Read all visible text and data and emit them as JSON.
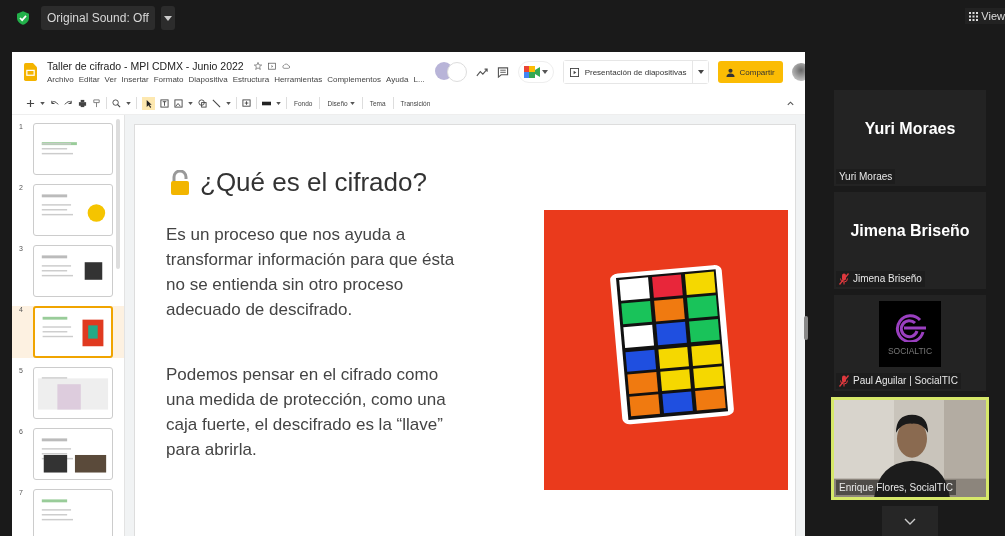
{
  "meeting_bar": {
    "original_sound": "Original Sound: Off",
    "view": "View"
  },
  "document": {
    "title": "Taller de cifrado - MPI CDMX - Junio 2022",
    "menu": [
      "Archivo",
      "Editar",
      "Ver",
      "Insertar",
      "Formato",
      "Diapositiva",
      "Estructura",
      "Herramientas",
      "Complementos",
      "Ayuda",
      "L..."
    ],
    "present_button": "Presentación de diapositivas",
    "share_button": "Compartir",
    "toolbar": [
      {
        "label": "Fondo",
        "dropdown": false
      },
      {
        "label": "Diseño",
        "dropdown": true
      },
      {
        "label": "Tema",
        "dropdown": false
      },
      {
        "label": "Transición",
        "dropdown": false
      }
    ]
  },
  "thumbnails": [
    {
      "number": "1",
      "selected": false
    },
    {
      "number": "2",
      "selected": false
    },
    {
      "number": "3",
      "selected": false
    },
    {
      "number": "4",
      "selected": true
    },
    {
      "number": "5",
      "selected": false
    },
    {
      "number": "6",
      "selected": false
    },
    {
      "number": "7",
      "selected": false
    }
  ],
  "slide": {
    "title": "¿Qué es el cifrado?",
    "paragraphs": [
      "Es un proceso que nos ayuda a transformar información para que ésta no se entienda sin otro proceso adecuado de descifrado.",
      "Podemos pensar en el cifrado como una medida de protección, como una caja fuerte, el descifrado es la “llave” para abrirla."
    ]
  },
  "participants": [
    {
      "kind": "name",
      "name": "Yuri Moraes",
      "label": "Yuri Moraes",
      "muted": false,
      "speaking": false
    },
    {
      "kind": "name",
      "name": "Jimena Briseño",
      "label": "Jimena Briseño",
      "muted": true,
      "speaking": false
    },
    {
      "kind": "logo",
      "logo_text": "SOCIALTIC",
      "label": "Paul Aguilar | SocialTIC",
      "muted": true,
      "speaking": false
    },
    {
      "kind": "video",
      "label": "Enrique Flores, SocialTIC",
      "muted": false,
      "speaking": true
    }
  ]
}
